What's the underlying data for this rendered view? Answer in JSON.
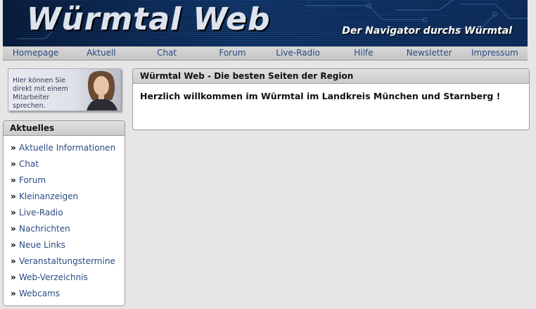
{
  "header": {
    "logo_text": "Würmtal Web",
    "slogan": "Der Navigator durchs Würmtal"
  },
  "nav": {
    "items": [
      {
        "label": "Homepage"
      },
      {
        "label": "Aktuell"
      },
      {
        "label": "Chat"
      },
      {
        "label": "Forum"
      },
      {
        "label": "Live-Radio"
      },
      {
        "label": "Hilfe"
      },
      {
        "label": "Newsletter"
      },
      {
        "label": "Impressum"
      }
    ]
  },
  "promo": {
    "text": "Hier können Sie direkt mit einem Mitarbeiter sprechen."
  },
  "sidebar": {
    "title": "Aktuelles",
    "bullet": "»",
    "items": [
      {
        "label": "Aktuelle Informationen"
      },
      {
        "label": "Chat"
      },
      {
        "label": "Forum"
      },
      {
        "label": "Kleinanzeigen"
      },
      {
        "label": "Live-Radio"
      },
      {
        "label": "Nachrichten"
      },
      {
        "label": "Neue Links"
      },
      {
        "label": "Veranstaltungstermine"
      },
      {
        "label": "Web-Verzeichnis"
      },
      {
        "label": "Webcams"
      }
    ]
  },
  "main": {
    "title": "Würmtal Web - Die besten Seiten der Region",
    "welcome": "Herzlich willkommen im Würmtal im Landkreis München und Starnberg !"
  },
  "colors": {
    "link": "#2b4a80",
    "banner_bg": "#0d2a55",
    "page_bg": "#e6e6e6"
  }
}
